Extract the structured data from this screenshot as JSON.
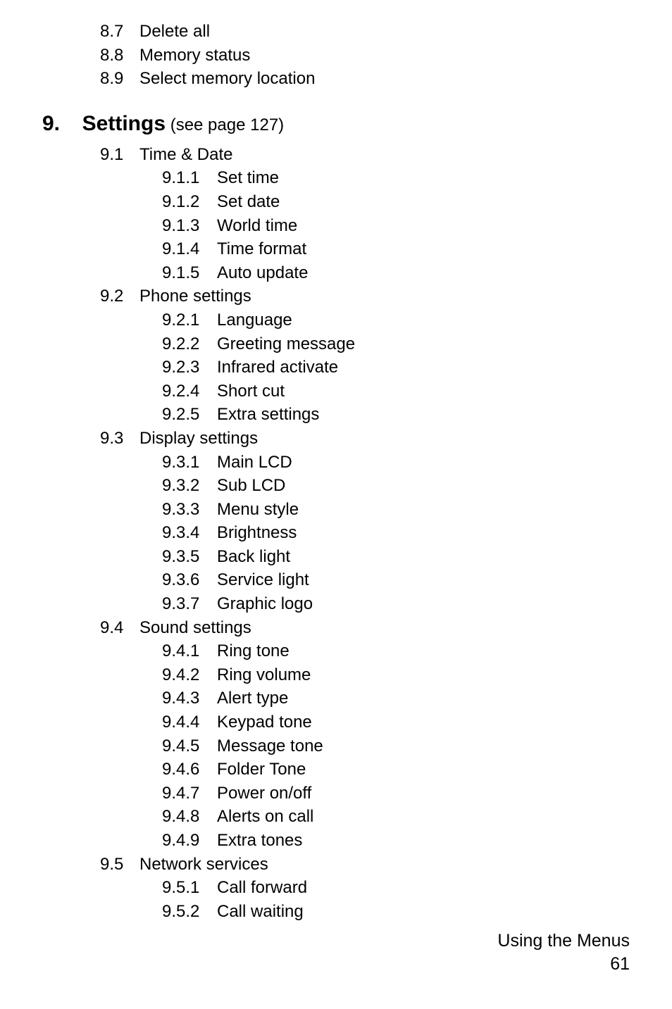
{
  "leading_items": [
    {
      "num": "8.7",
      "label": "Delete all"
    },
    {
      "num": "8.8",
      "label": "Memory status"
    },
    {
      "num": "8.9",
      "label": "Select memory location"
    }
  ],
  "chapter": {
    "num": "9.",
    "title": "Settings",
    "see": "(see page 127)"
  },
  "sections": [
    {
      "num": "9.1",
      "label": "Time & Date",
      "children": [
        {
          "num": "9.1.1",
          "label": "Set time"
        },
        {
          "num": "9.1.2",
          "label": "Set date"
        },
        {
          "num": "9.1.3",
          "label": "World time"
        },
        {
          "num": "9.1.4",
          "label": "Time format"
        },
        {
          "num": "9.1.5",
          "label": "Auto update"
        }
      ]
    },
    {
      "num": "9.2",
      "label": "Phone settings",
      "children": [
        {
          "num": "9.2.1",
          "label": "Language"
        },
        {
          "num": "9.2.2",
          "label": "Greeting message"
        },
        {
          "num": "9.2.3",
          "label": "Infrared activate"
        },
        {
          "num": "9.2.4",
          "label": "Short cut"
        },
        {
          "num": "9.2.5",
          "label": "Extra settings"
        }
      ]
    },
    {
      "num": "9.3",
      "label": "Display settings",
      "children": [
        {
          "num": "9.3.1",
          "label": "Main LCD"
        },
        {
          "num": "9.3.2",
          "label": "Sub LCD"
        },
        {
          "num": "9.3.3",
          "label": "Menu style"
        },
        {
          "num": "9.3.4",
          "label": "Brightness"
        },
        {
          "num": "9.3.5",
          "label": "Back light"
        },
        {
          "num": "9.3.6",
          "label": "Service light"
        },
        {
          "num": "9.3.7",
          "label": "Graphic logo"
        }
      ]
    },
    {
      "num": "9.4",
      "label": "Sound settings",
      "children": [
        {
          "num": "9.4.1",
          "label": "Ring tone"
        },
        {
          "num": "9.4.2",
          "label": "Ring volume"
        },
        {
          "num": "9.4.3",
          "label": "Alert type"
        },
        {
          "num": "9.4.4",
          "label": "Keypad tone"
        },
        {
          "num": "9.4.5",
          "label": "Message tone"
        },
        {
          "num": "9.4.6",
          "label": "Folder Tone"
        },
        {
          "num": "9.4.7",
          "label": "Power on/off"
        },
        {
          "num": "9.4.8",
          "label": "Alerts on call"
        },
        {
          "num": "9.4.9",
          "label": "Extra tones"
        }
      ]
    },
    {
      "num": "9.5",
      "label": "Network services",
      "children": [
        {
          "num": "9.5.1",
          "label": "Call forward"
        },
        {
          "num": "9.5.2",
          "label": "Call waiting"
        }
      ]
    }
  ],
  "footer": {
    "section": "Using the Menus",
    "page": "61"
  }
}
